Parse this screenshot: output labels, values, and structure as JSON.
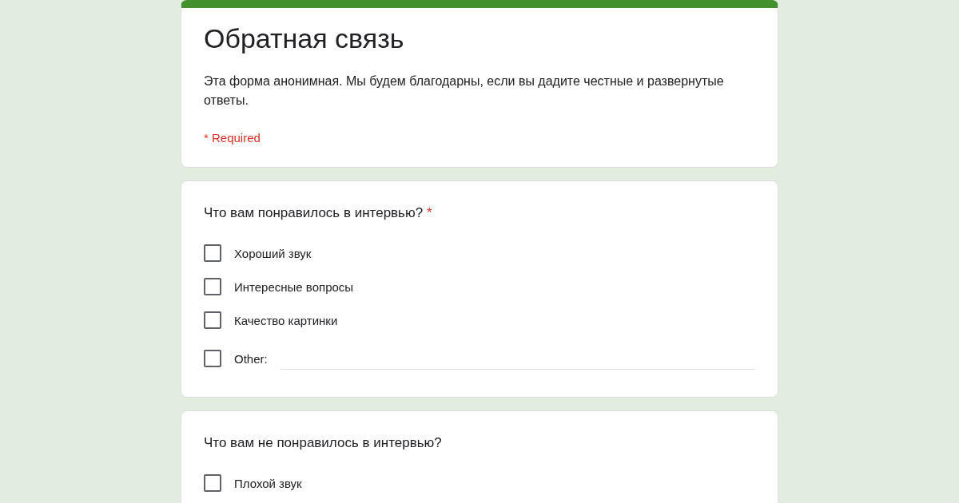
{
  "form": {
    "title": "Обратная связь",
    "description": "Эта форма анонимная. Мы будем благодарны, если вы дадите честные и развернутые ответы.",
    "required_note": "* Required"
  },
  "questions": [
    {
      "title": "Что вам понравилось в интервью?",
      "required_mark": "*",
      "options": [
        {
          "kind": "option",
          "label": "Хороший звук",
          "checked": false
        },
        {
          "kind": "option",
          "label": "Интересные вопросы",
          "checked": false
        },
        {
          "kind": "option",
          "label": "Качество картинки",
          "checked": false
        },
        {
          "kind": "other",
          "label": "Other:",
          "checked": false
        }
      ]
    },
    {
      "title": "Что вам не понравилось в интервью?",
      "options": [
        {
          "kind": "option",
          "label": "Плохой звук",
          "checked": false
        }
      ]
    }
  ]
}
